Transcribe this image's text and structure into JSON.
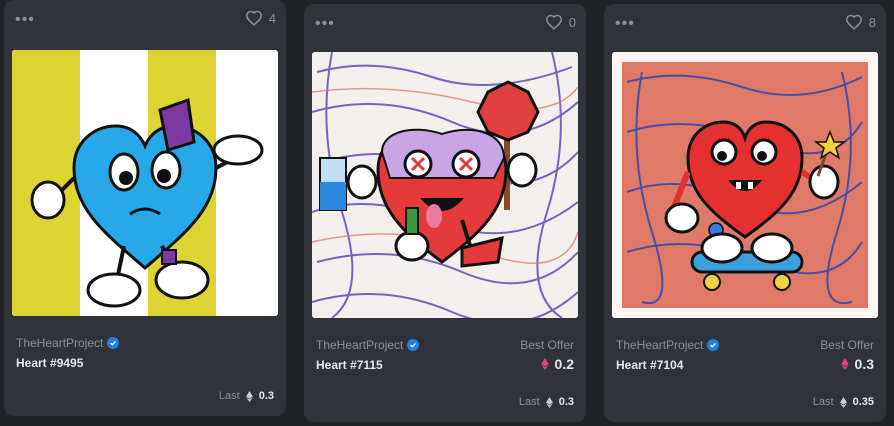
{
  "cards": [
    {
      "likes": "4",
      "collection": "TheHeartProject",
      "name": "Heart #9495",
      "best_offer_label": "",
      "best_offer_price": "",
      "last_label": "Last",
      "last_price": "0.3",
      "art": "heart-blue-on-yellow-stripes"
    },
    {
      "likes": "0",
      "collection": "TheHeartProject",
      "name": "Heart #7115",
      "best_offer_label": "Best Offer",
      "best_offer_price": "0.2",
      "last_label": "Last",
      "last_price": "0.3",
      "art": "heart-pink-stop-sign"
    },
    {
      "likes": "8",
      "collection": "TheHeartProject",
      "name": "Heart #7104",
      "best_offer_label": "Best Offer",
      "best_offer_price": "0.3",
      "last_label": "Last",
      "last_price": "0.35",
      "art": "heart-red-skateboard"
    }
  ],
  "colors": {
    "background": "#202225",
    "card": "#303339",
    "muted_text": "#8a939b",
    "verified": "#2081e2",
    "eth_pink": "#e2457a"
  },
  "icons": {
    "menu": "ellipsis-icon",
    "like": "heart-outline-icon",
    "verified": "verified-badge-icon",
    "currency": "ethereum-icon"
  }
}
